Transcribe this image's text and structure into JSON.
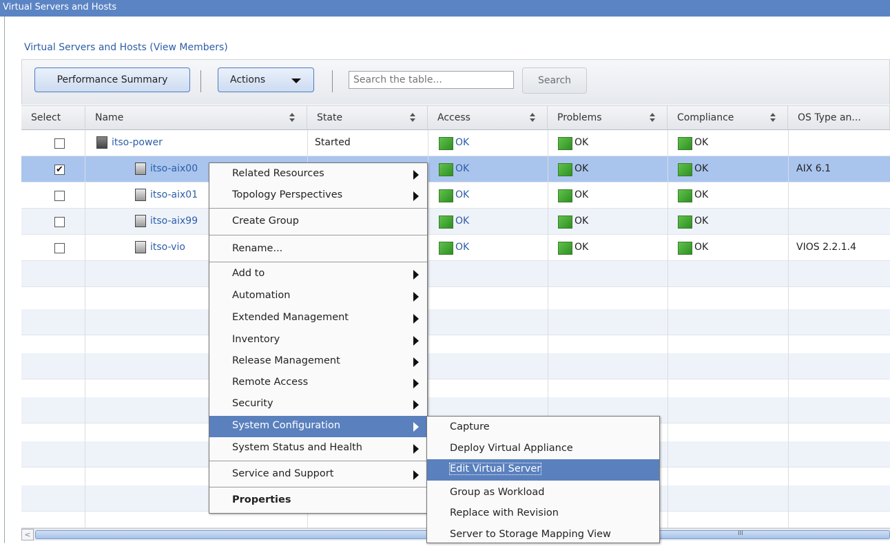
{
  "window": {
    "title": "Virtual Servers and Hosts"
  },
  "panel": {
    "title": "Virtual Servers and Hosts (View Members)"
  },
  "toolbar": {
    "performance_label": "Performance Summary",
    "actions_label": "Actions",
    "search_placeholder": "Search the table...",
    "search_label": "Search"
  },
  "table": {
    "columns": [
      "Select",
      "Name",
      "State",
      "Access",
      "Problems",
      "Compliance",
      "OS Type an..."
    ],
    "rows": [
      {
        "selected": false,
        "name": "itso-power",
        "state": "Started",
        "access": "OK",
        "problems": "OK",
        "compliance": "OK",
        "os": ""
      },
      {
        "selected": true,
        "name": "itso-aix00",
        "state": "",
        "access": "OK",
        "problems": "OK",
        "compliance": "OK",
        "os": "AIX 6.1"
      },
      {
        "selected": false,
        "name": "itso-aix01",
        "state": "",
        "access": "OK",
        "problems": "OK",
        "compliance": "OK",
        "os": ""
      },
      {
        "selected": false,
        "name": "itso-aix99",
        "state": "",
        "access": "OK",
        "problems": "OK",
        "compliance": "OK",
        "os": ""
      },
      {
        "selected": false,
        "name": "itso-vio",
        "state": "",
        "access": "OK",
        "problems": "OK",
        "compliance": "OK",
        "os": "VIOS 2.2.1.4"
      }
    ]
  },
  "context_menu": {
    "items": [
      {
        "label": "Related Resources",
        "submenu": true
      },
      {
        "label": "Topology Perspectives",
        "submenu": true
      },
      {
        "label": "Create Group",
        "submenu": false
      },
      {
        "label": "Rename...",
        "submenu": false
      },
      {
        "label": "Add to",
        "submenu": true
      },
      {
        "label": "Automation",
        "submenu": true
      },
      {
        "label": "Extended Management",
        "submenu": true
      },
      {
        "label": "Inventory",
        "submenu": true
      },
      {
        "label": "Release Management",
        "submenu": true
      },
      {
        "label": "Remote Access",
        "submenu": true
      },
      {
        "label": "Security",
        "submenu": true
      },
      {
        "label": "System Configuration",
        "submenu": true,
        "highlighted": true
      },
      {
        "label": "System Status and Health",
        "submenu": true
      },
      {
        "label": "Service and Support",
        "submenu": true
      },
      {
        "label": "Properties",
        "submenu": false
      }
    ]
  },
  "submenu": {
    "items": [
      {
        "label": "Capture"
      },
      {
        "label": "Deploy Virtual Appliance"
      },
      {
        "label": "Edit Virtual Server",
        "highlighted": true
      },
      {
        "label": "Group as Workload"
      },
      {
        "label": "Replace with Revision"
      },
      {
        "label": "Server to Storage Mapping View"
      }
    ]
  },
  "colors": {
    "accent": "#5a80be",
    "titlebar": "#5b84c4",
    "selected_row": "#a9c5ee",
    "link": "#2d5da8",
    "ok_green": "#3fa52f"
  },
  "icons": {
    "server": "server-icon",
    "ok": "ok-status-icon",
    "submenu": "submenu-arrow-icon"
  }
}
